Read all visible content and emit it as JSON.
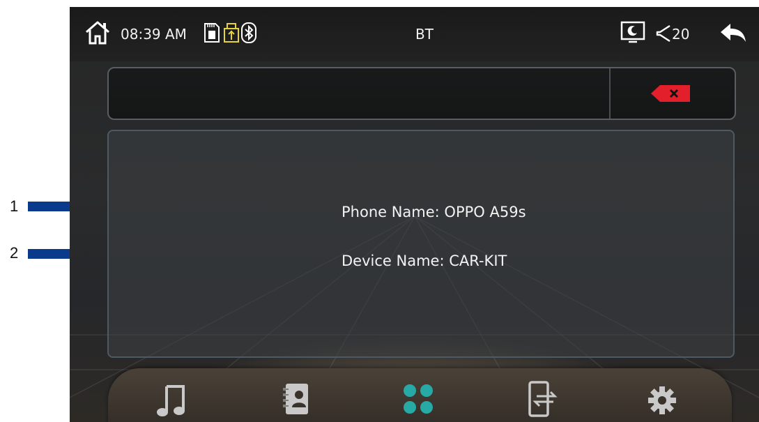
{
  "annotations": [
    {
      "number": "1"
    },
    {
      "number": "2"
    }
  ],
  "statusbar": {
    "home_icon": "home-icon",
    "time": "08:39 AM",
    "sd_icon": "sd-card-icon",
    "usb_icon": "usb-icon",
    "bt_icon": "bluetooth-icon",
    "title": "BT",
    "display_icon": "display-mode-icon",
    "volume_icon": "volume-icon",
    "volume": "20",
    "back_icon": "back-icon"
  },
  "search": {
    "value": "",
    "delete_icon": "backspace-icon"
  },
  "info": {
    "phone_name": "Phone Name:  OPPO A59s",
    "device_name": "Device Name:  CAR-KIT"
  },
  "dock": {
    "items": [
      "music-icon",
      "contacts-icon",
      "dialpad-icon",
      "phone-transfer-icon",
      "settings-icon"
    ],
    "active_index": 2
  },
  "colors": {
    "accent": "#27a9a6",
    "delete_red": "#e41f2c",
    "arrow_yellow": "#ffff00",
    "bar_blue": "#0a3a8c"
  }
}
